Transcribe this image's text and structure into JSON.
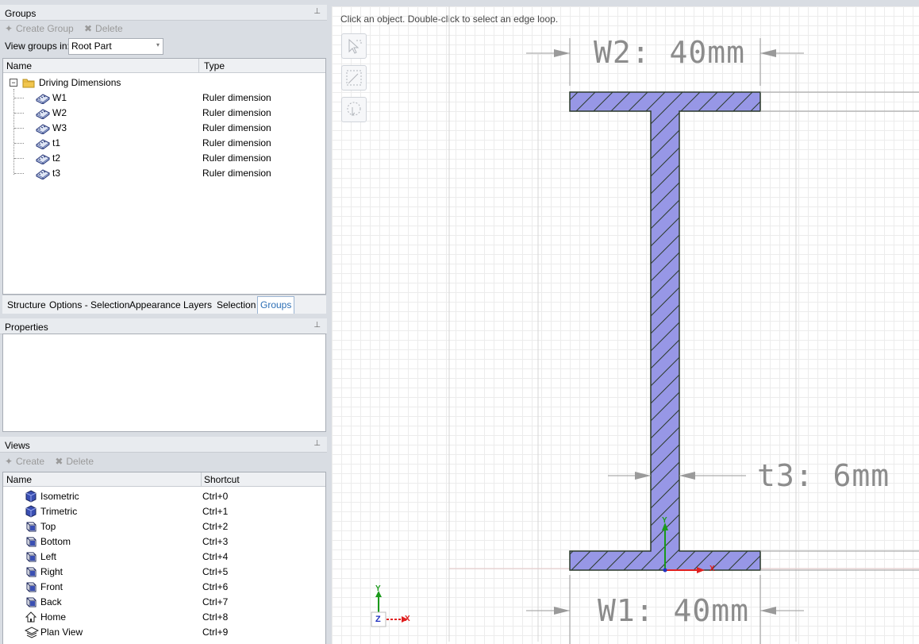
{
  "groups_panel": {
    "title": "Groups",
    "pin": "📌",
    "create_group": "Create Group",
    "delete": "Delete",
    "view_groups_in_label": "View groups in:",
    "view_groups_in_value": "Root Part",
    "columns": {
      "name": "Name",
      "type": "Type"
    },
    "root_item": "Driving Dimensions",
    "items": [
      {
        "name": "W1",
        "type": "Ruler dimension"
      },
      {
        "name": "W2",
        "type": "Ruler dimension"
      },
      {
        "name": "W3",
        "type": "Ruler dimension"
      },
      {
        "name": "t1",
        "type": "Ruler dimension"
      },
      {
        "name": "t2",
        "type": "Ruler dimension"
      },
      {
        "name": "t3",
        "type": "Ruler dimension"
      }
    ]
  },
  "tabs": [
    "Structure",
    "Options - Selection",
    "Appearance",
    "Layers",
    "Selection",
    "Groups"
  ],
  "properties_panel": {
    "title": "Properties"
  },
  "views_panel": {
    "title": "Views",
    "create": "Create",
    "delete": "Delete",
    "columns": {
      "name": "Name",
      "shortcut": "Shortcut"
    },
    "items": [
      {
        "name": "Isometric",
        "shortcut": "Ctrl+0"
      },
      {
        "name": "Trimetric",
        "shortcut": "Ctrl+1"
      },
      {
        "name": "Top",
        "shortcut": "Ctrl+2"
      },
      {
        "name": "Bottom",
        "shortcut": "Ctrl+3"
      },
      {
        "name": "Left",
        "shortcut": "Ctrl+4"
      },
      {
        "name": "Right",
        "shortcut": "Ctrl+5"
      },
      {
        "name": "Front",
        "shortcut": "Ctrl+6"
      },
      {
        "name": "Back",
        "shortcut": "Ctrl+7"
      },
      {
        "name": "Home",
        "shortcut": "Ctrl+8"
      },
      {
        "name": "Plan View",
        "shortcut": "Ctrl+9"
      }
    ]
  },
  "viewport": {
    "hint": "Click an object. Double-click to select an edge loop.",
    "dim_w2": "W2: 40mm",
    "dim_w1": "W1: 40mm",
    "dim_t3": "t3: 6mm",
    "axis_y": "Y",
    "axis_x": "X",
    "axis_z": "Z"
  },
  "colors": {
    "section_fill": "#9797e6",
    "section_stroke": "#2b3a2b",
    "dim_text": "#8c8c8c",
    "axis_x": "#e02020",
    "axis_y": "#1a9a1a",
    "axis_z": "#2030c0",
    "tab_active": "#2d6fb5"
  }
}
